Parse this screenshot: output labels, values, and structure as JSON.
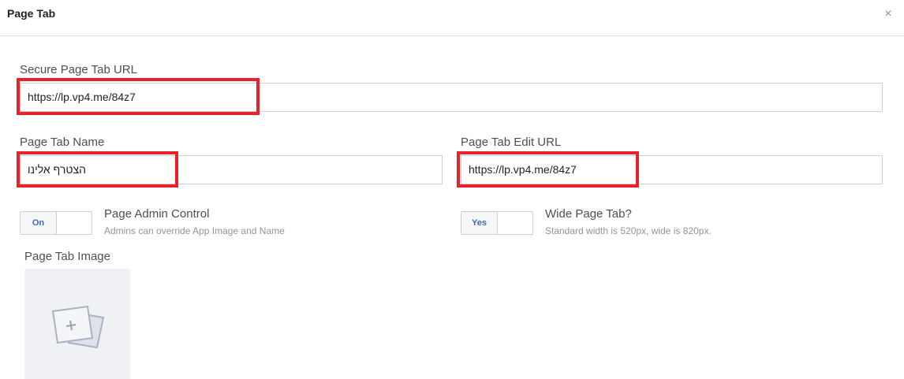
{
  "header": {
    "title": "Page Tab",
    "close_glyph": "×"
  },
  "secure_url": {
    "label": "Secure Page Tab URL",
    "value": "https://lp.vp4.me/84z7"
  },
  "tab_name": {
    "label": "Page Tab Name",
    "value": "הצטרף אלינו"
  },
  "edit_url": {
    "label": "Page Tab Edit URL",
    "value": "https://lp.vp4.me/84z7"
  },
  "admin_control": {
    "toggle_label": "On",
    "title": "Page Admin Control",
    "subtitle": "Admins can override App Image and Name"
  },
  "wide_tab": {
    "toggle_label": "Yes",
    "title": "Wide Page Tab?",
    "subtitle": "Standard width is 520px, wide is 820px."
  },
  "image": {
    "label": "Page Tab Image",
    "icon": "add-image-icon"
  },
  "colors": {
    "highlight": "#e8212b",
    "toggle_text": "#4267b2"
  }
}
